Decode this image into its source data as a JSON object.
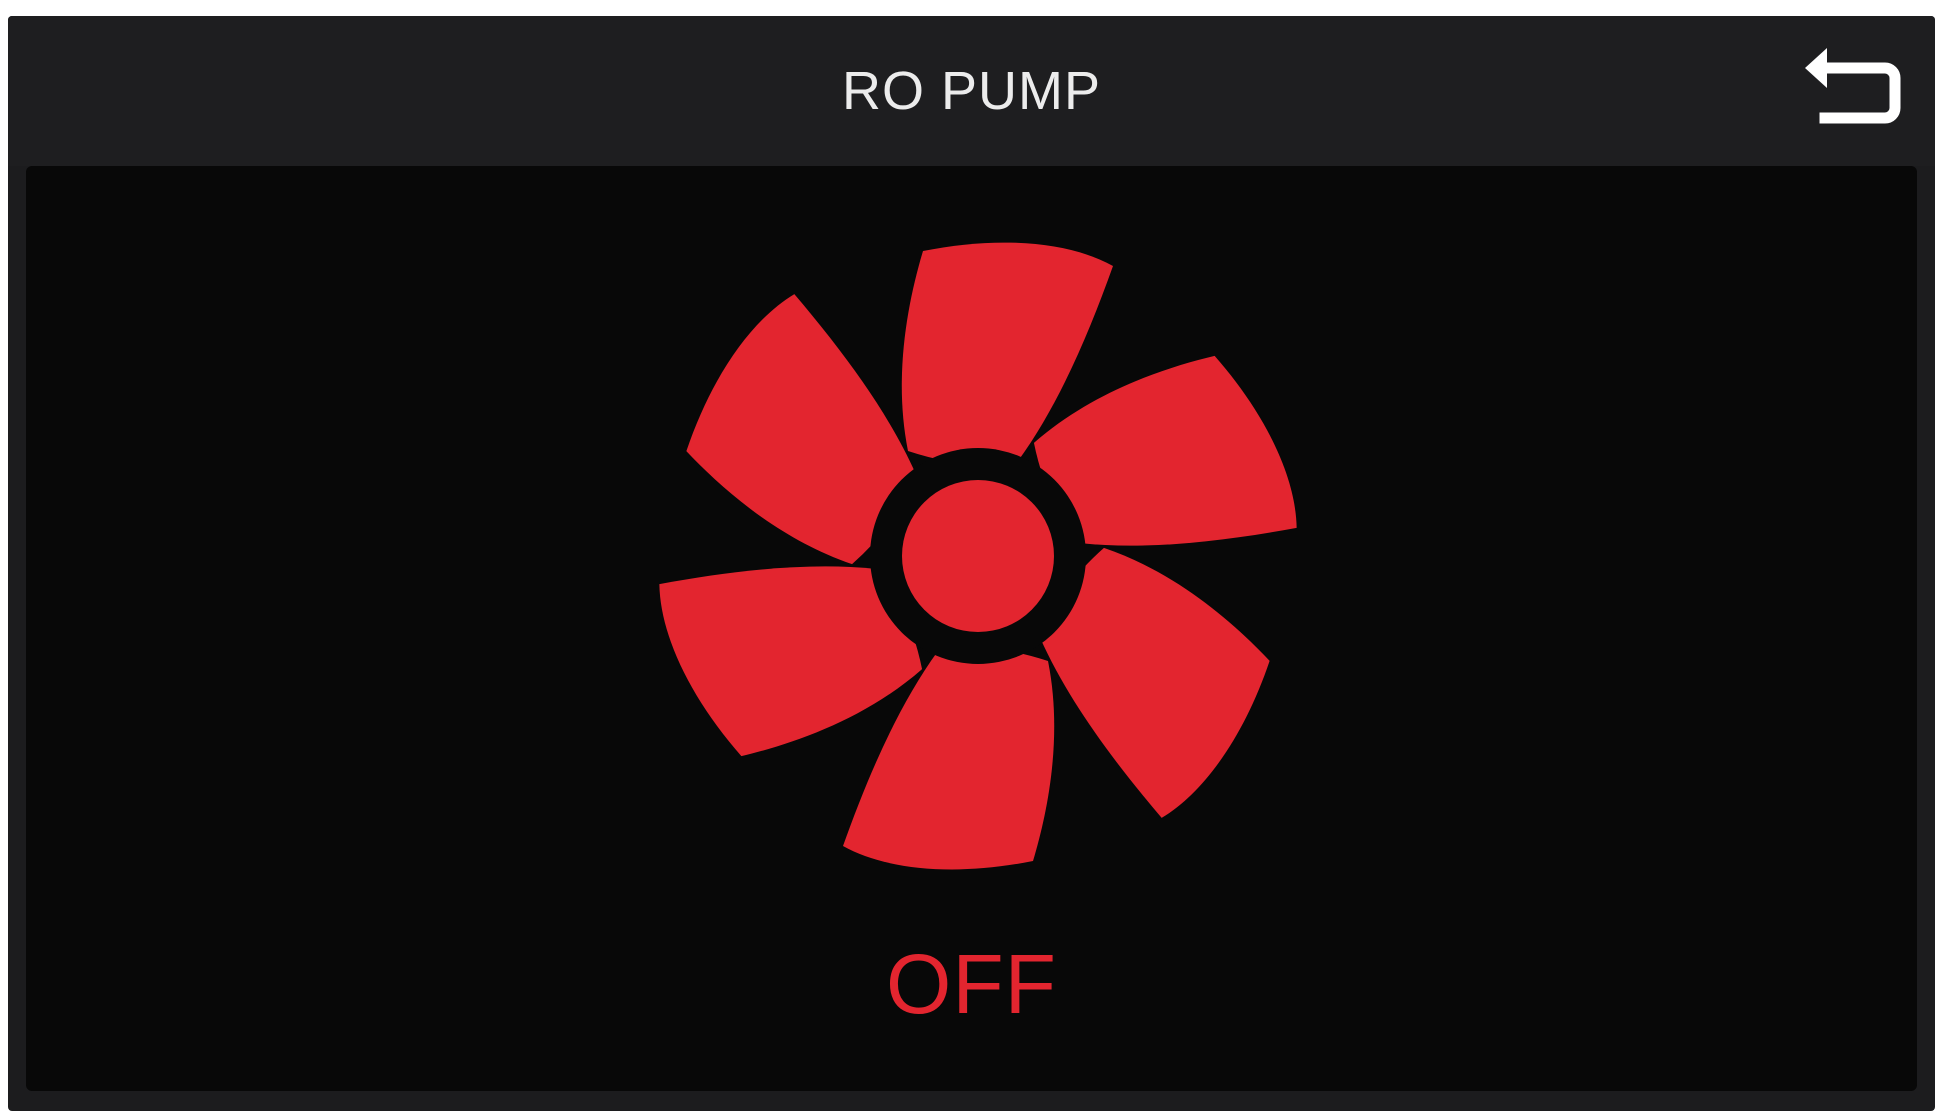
{
  "header": {
    "title": "RO PUMP",
    "back_icon": "return-arrow-icon"
  },
  "pump": {
    "icon": "fan-icon",
    "status": "OFF",
    "status_color": "#e3252f",
    "fan_color": "#e3252f"
  },
  "colors": {
    "header_bg": "#1e1e20",
    "content_bg": "#080808",
    "title_text": "#ececec"
  }
}
